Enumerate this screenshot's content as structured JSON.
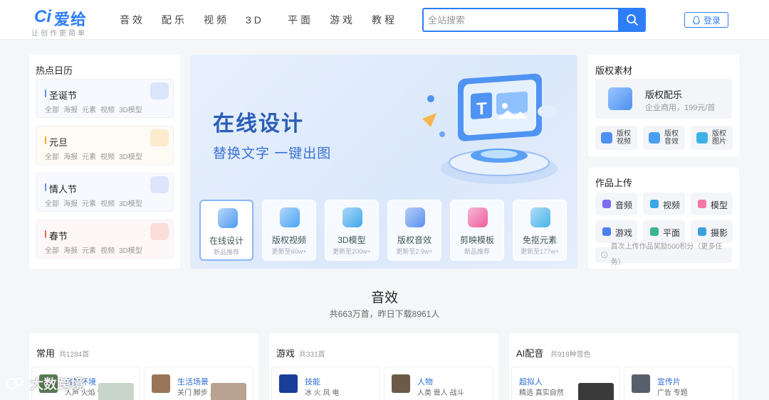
{
  "logo": {
    "mark": "Ci",
    "name": "爱给",
    "slogan": "让创作更简单"
  },
  "nav": [
    "音效",
    "配乐",
    "视频",
    "3D",
    "平面",
    "游戏",
    "教程"
  ],
  "search": {
    "value": "",
    "placeholder": "全站搜索",
    "icon": "search-icon"
  },
  "login": {
    "label": "登录",
    "icon": "qq-penguin-icon"
  },
  "hot_calendar": {
    "title": "热点日历",
    "items": [
      {
        "name": "圣诞节",
        "tags": [
          "全部",
          "海报",
          "元素",
          "视频",
          "3D模型"
        ],
        "accent": "#5b8def",
        "decoration": "snowflake-icon"
      },
      {
        "name": "元旦",
        "tags": [
          "全部",
          "海报",
          "元素",
          "视频",
          "3D模型"
        ],
        "accent": "#f5a623",
        "decoration": "calendar-icon"
      },
      {
        "name": "情人节",
        "tags": [
          "全部",
          "海报",
          "元素",
          "视频",
          "3D模型"
        ],
        "accent": "#6b8cf5",
        "decoration": "heart-icon"
      },
      {
        "name": "春节",
        "tags": [
          "全部",
          "海报",
          "元素",
          "视频",
          "3D模型"
        ],
        "accent": "#ef6a5b",
        "decoration": "lantern-icon"
      }
    ]
  },
  "banner": {
    "title": "在线设计",
    "subtitle": "替换文字 一键出图",
    "quick_links": [
      {
        "label": "在线设计",
        "sub": "新品推荐",
        "icon": "monitor-icon",
        "color": "#4d9af2"
      },
      {
        "label": "版权视频",
        "sub": "更新至60w+",
        "icon": "video-icon",
        "color": "#4aa3f5"
      },
      {
        "label": "3D模型",
        "sub": "更新至200w+",
        "icon": "cube-icon",
        "color": "#41a6ee"
      },
      {
        "label": "版权音效",
        "sub": "更新至2.9w+",
        "icon": "speaker-icon",
        "color": "#5a8ff0"
      },
      {
        "label": "剪映模板",
        "sub": "新品推荐",
        "icon": "capcut-icon",
        "color": "#f05a9a"
      },
      {
        "label": "免抠元素",
        "sub": "更新至177w+",
        "icon": "image-cutout-icon",
        "color": "#46b3e8"
      }
    ]
  },
  "copyright": {
    "title": "版权素材",
    "music": {
      "title": "版权配乐",
      "desc": "企业商用，199元/首"
    },
    "tiles": [
      {
        "label": "版权视频",
        "icon": "video-icon",
        "color": "#4e8ff3"
      },
      {
        "label": "版权音效",
        "icon": "speaker-icon",
        "color": "#4aa0f0"
      },
      {
        "label": "版权图片",
        "icon": "picture-icon",
        "color": "#3fb1e9"
      }
    ]
  },
  "upload": {
    "title": "作品上传",
    "tiles": [
      {
        "label": "音频",
        "icon": "audio-icon",
        "color": "#7b6cf0"
      },
      {
        "label": "视频",
        "icon": "video-icon",
        "color": "#3aa8e6"
      },
      {
        "label": "模型",
        "icon": "model-icon",
        "color": "#f07aa4"
      },
      {
        "label": "游戏",
        "icon": "gamepad-icon",
        "color": "#4d7ff0"
      },
      {
        "label": "平面",
        "icon": "picture-icon",
        "color": "#3cb58a"
      },
      {
        "label": "摄影",
        "icon": "camera-icon",
        "color": "#3aa0e0"
      }
    ],
    "note": "首次上传作品奖励500积分（更多任务）"
  },
  "sound_section": {
    "title": "音效",
    "subtitle": "共663万首，昨日下载8961人",
    "categories": [
      {
        "name": "常用",
        "count": "共1284首",
        "items": [
          {
            "name": "自然环境",
            "tags": "人声 火焰 雷雨",
            "thumb": "#5a7a55",
            "photo": "#c8d6c9"
          },
          {
            "name": "生活场景",
            "tags": "关门 脚步 人群",
            "thumb": "#9a7456",
            "photo": "#b8a392"
          }
        ]
      },
      {
        "name": "游戏",
        "count": "共331首",
        "items": [
          {
            "name": "技能",
            "tags": "冰 火 风 电",
            "thumb": "#1b3d9a",
            "photo": ""
          },
          {
            "name": "人物",
            "tags": "人类 兽人 战斗",
            "thumb": "#6b5a48",
            "photo": ""
          }
        ]
      },
      {
        "name": "AI配音",
        "count": "共918种音色",
        "items": [
          {
            "name": "超拟人",
            "tags": "精选 真实自然",
            "thumb": "",
            "photo": "#3a3a3a"
          },
          {
            "name": "宣传片",
            "tags": "广告 专题",
            "thumb": "#55606a",
            "photo": ""
          }
        ]
      }
    ]
  },
  "watermark": {
    "text": "大数跨境"
  }
}
